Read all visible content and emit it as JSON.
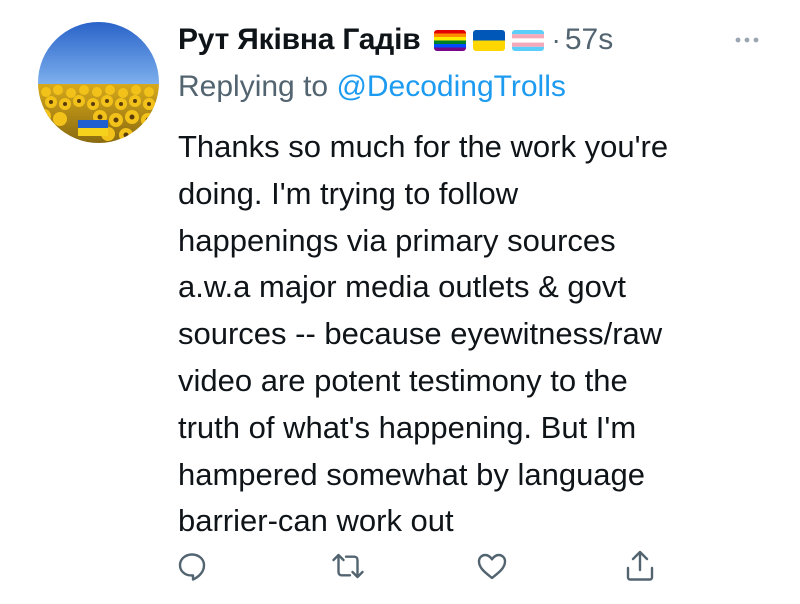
{
  "tweet": {
    "author": {
      "display_name": "Рут Яківна Гадів",
      "flags": [
        {
          "icon": "rainbow-flag-icon",
          "colors": [
            "#e40303",
            "#ff8c00",
            "#ffed00",
            "#008026",
            "#004dff",
            "#750787"
          ]
        },
        {
          "icon": "ukraine-flag-icon",
          "colors": [
            "#0057b7",
            "#ffd700"
          ]
        },
        {
          "icon": "transgender-flag-icon",
          "colors": [
            "#5bcefa",
            "#f5a9b8",
            "#ffffff",
            "#f5a9b8",
            "#5bcefa"
          ]
        }
      ]
    },
    "separator": "·",
    "timestamp": "57s",
    "replying_to_prefix": "Replying to",
    "replying_to_handle": "@DecodingTrolls",
    "text": "Thanks so much for the work you're\ndoing. I'm trying to follow\nhappenings via primary sources\na.w.a major media outlets & govt\nsources -- because eyewitness/raw\nvideo are potent testimony to the\ntruth of what's happening. But I'm\nhampered somewhat by language\nbarrier-can work out",
    "actions": [
      {
        "name": "reply",
        "icon": "reply-icon"
      },
      {
        "name": "retweet",
        "icon": "retweet-icon"
      },
      {
        "name": "like",
        "icon": "heart-icon"
      },
      {
        "name": "share",
        "icon": "share-icon"
      }
    ],
    "more_icon": "more-icon"
  },
  "colors": {
    "text_primary": "#0f1419",
    "text_secondary": "#536471",
    "accent": "#1d9bf0"
  }
}
